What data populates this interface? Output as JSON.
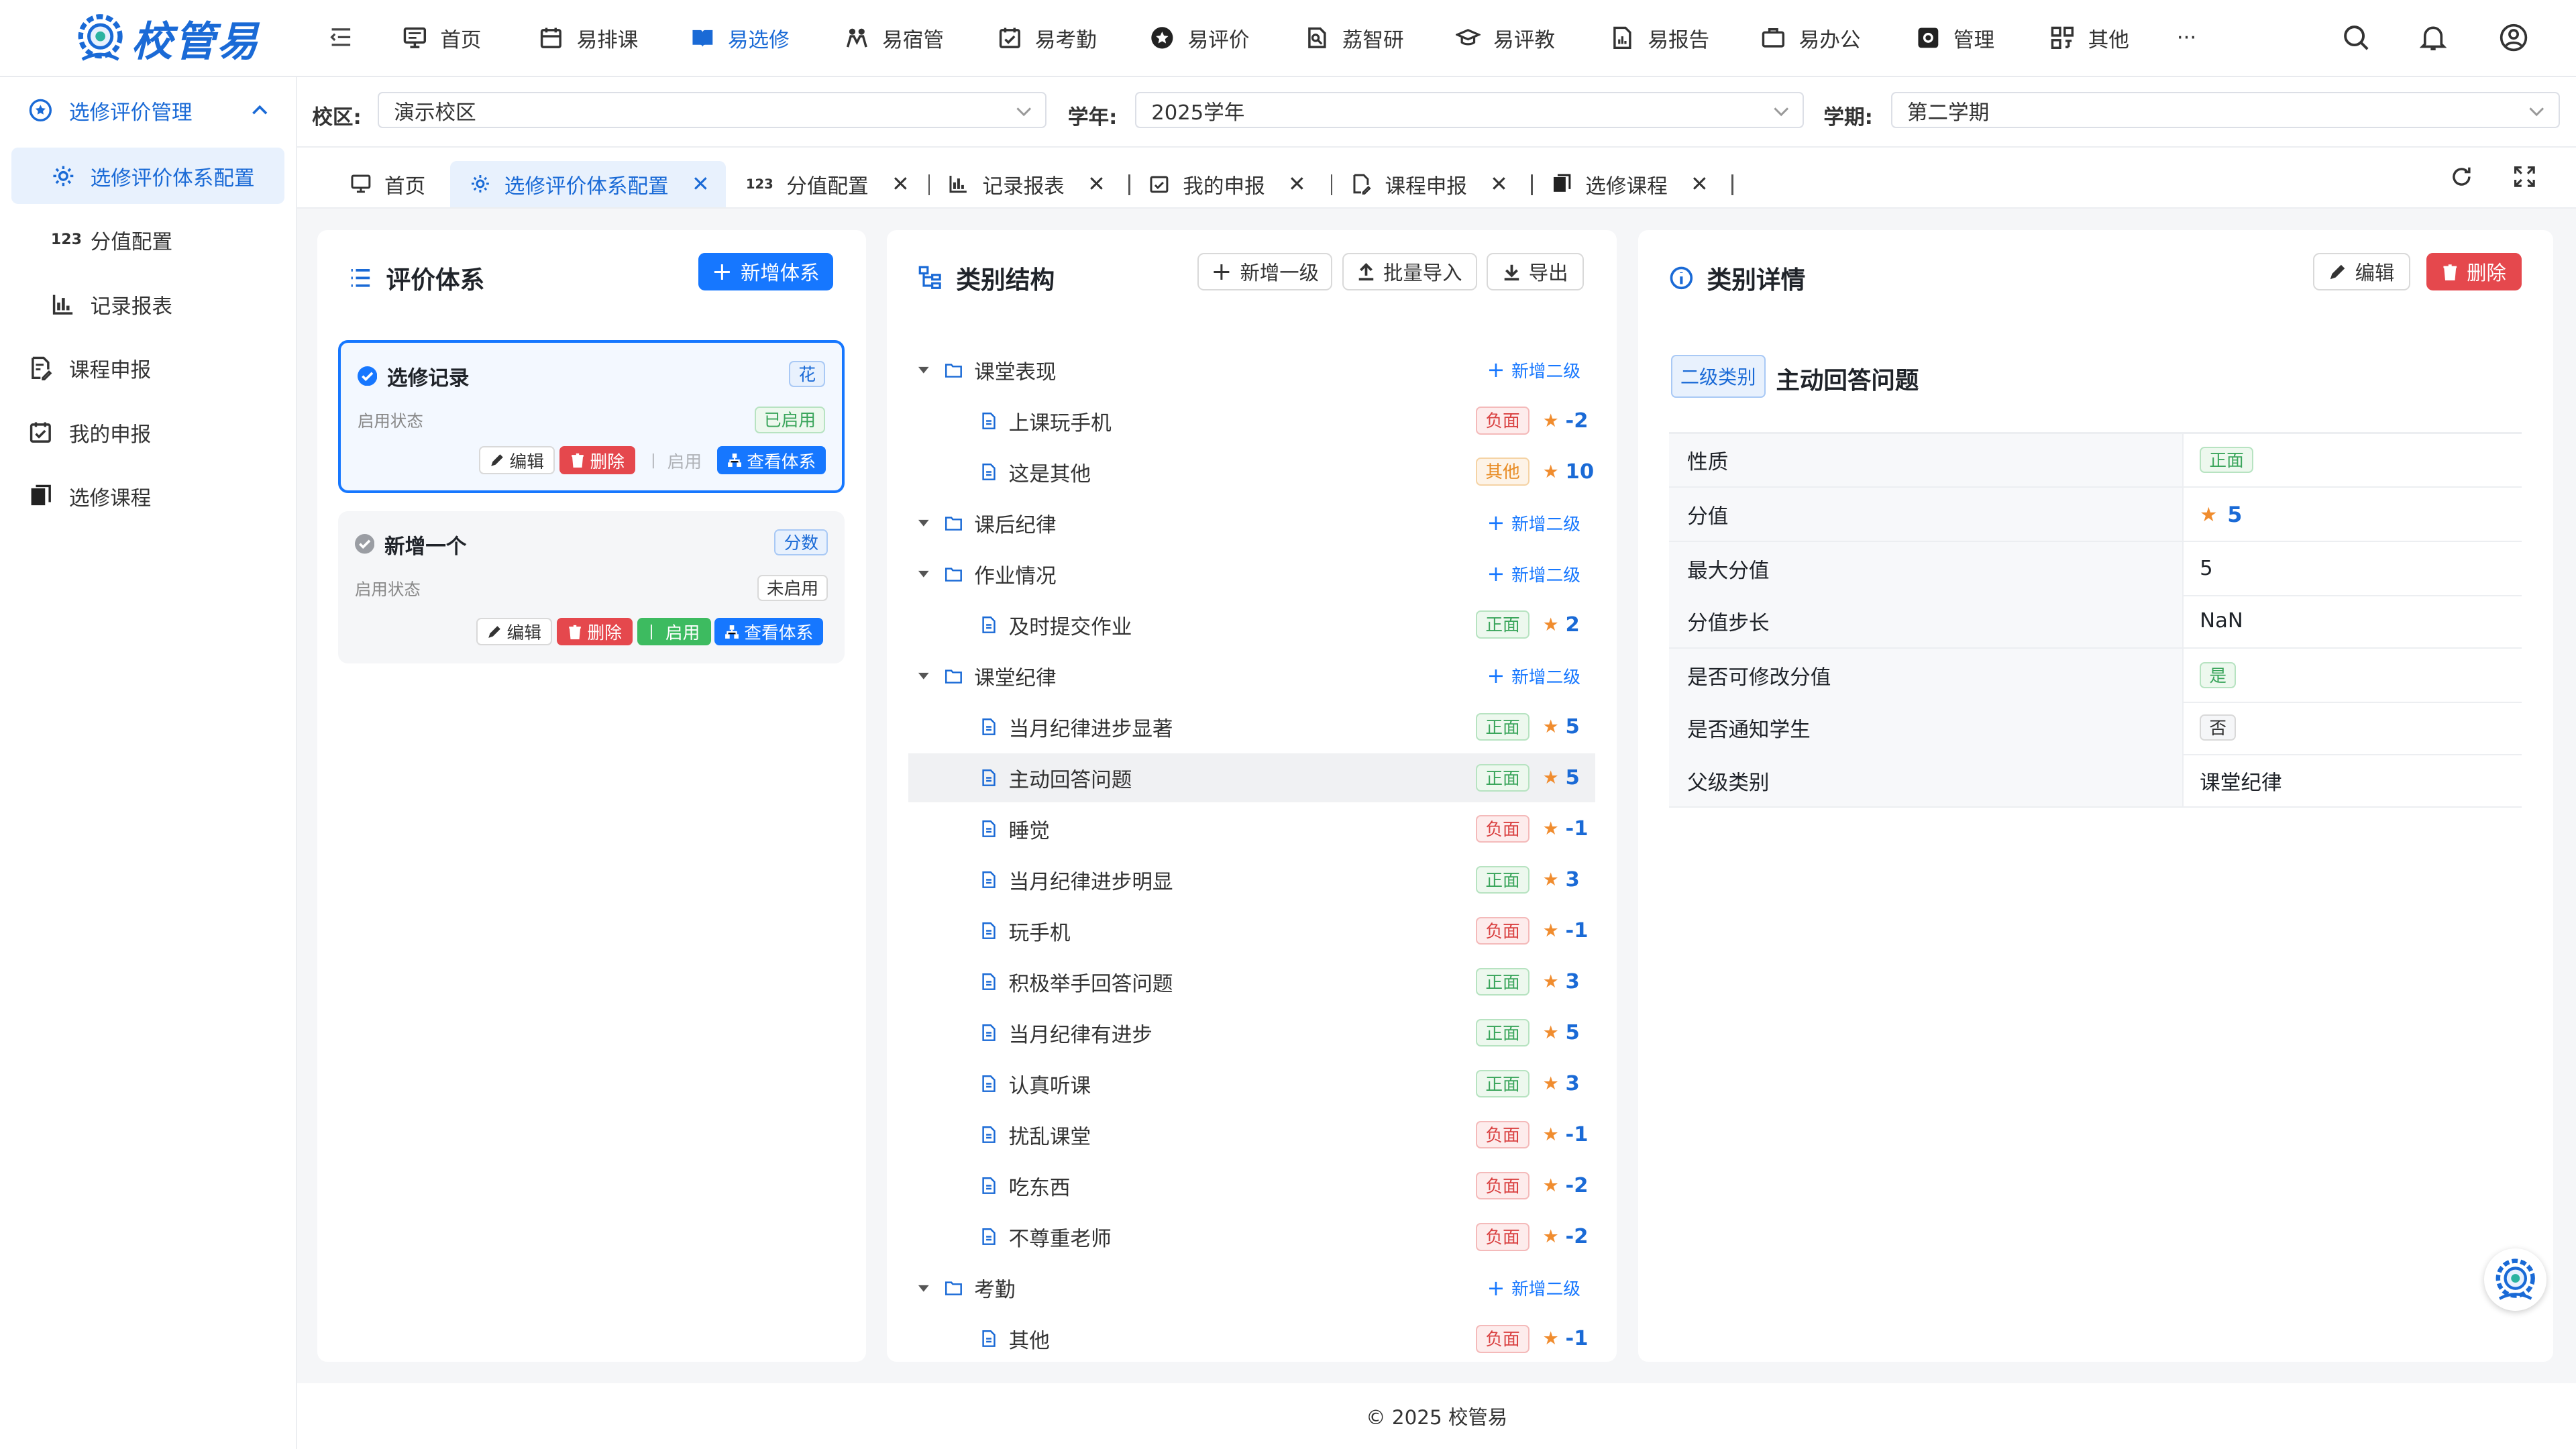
{
  "app": {
    "logo_text": "校管易"
  },
  "nav": {
    "items": [
      {
        "label": "首页",
        "icon": "monitor-icon"
      },
      {
        "label": "易排课",
        "icon": "calendar-icon"
      },
      {
        "label": "易选修",
        "icon": "book-icon"
      },
      {
        "label": "易宿管",
        "icon": "users-icon"
      },
      {
        "label": "易考勤",
        "icon": "calendar-check-icon"
      },
      {
        "label": "易评价",
        "icon": "star-icon"
      },
      {
        "label": "荔智研",
        "icon": "research-icon"
      },
      {
        "label": "易评教",
        "icon": "graduation-icon"
      },
      {
        "label": "易报告",
        "icon": "report-icon"
      },
      {
        "label": "易办公",
        "icon": "briefcase-icon"
      },
      {
        "label": "管理",
        "icon": "settings-icon"
      },
      {
        "label": "其他",
        "icon": "grid-icon"
      }
    ],
    "more": "···"
  },
  "sidebar": {
    "group": "选修评价管理",
    "items": [
      {
        "label": "选修评价体系配置"
      },
      {
        "label": "分值配置"
      },
      {
        "label": "记录报表"
      },
      {
        "label": "课程申报"
      },
      {
        "label": "我的申报"
      },
      {
        "label": "选修课程"
      }
    ]
  },
  "filters": {
    "campus_label": "校区:",
    "campus_value": "演示校区",
    "year_label": "学年:",
    "year_value": "2025学年",
    "term_label": "学期:",
    "term_value": "第二学期"
  },
  "tabs": [
    {
      "label": "首页"
    },
    {
      "label": "选修评价体系配置"
    },
    {
      "label": "分值配置"
    },
    {
      "label": "记录报表"
    },
    {
      "label": "我的申报"
    },
    {
      "label": "课程申报"
    },
    {
      "label": "选修课程"
    }
  ],
  "systems_panel": {
    "title": "评价体系",
    "add_button": "新增体系",
    "cards": [
      {
        "name": "选修记录",
        "type_tag": "花",
        "status_label": "启用状态",
        "status": "已启用",
        "edit": "编辑",
        "delete": "删除",
        "enable": "启用",
        "view": "查看体系"
      },
      {
        "name": "新增一个",
        "type_tag": "分数",
        "status_label": "启用状态",
        "status": "未启用",
        "edit": "编辑",
        "delete": "删除",
        "enable": "启用",
        "view": "查看体系"
      }
    ]
  },
  "tree_panel": {
    "title": "类别结构",
    "btn_add_level1": "新增一级",
    "btn_import": "批量导入",
    "btn_export": "导出",
    "add_sub_label": "新增二级",
    "groups": [
      {
        "name": "课堂表现",
        "children": [
          {
            "name": "上课玩手机",
            "nature": "负面",
            "score": "-2"
          },
          {
            "name": "这是其他",
            "nature": "其他",
            "score": "10"
          }
        ]
      },
      {
        "name": "课后纪律",
        "children": []
      },
      {
        "name": "作业情况",
        "children": [
          {
            "name": "及时提交作业",
            "nature": "正面",
            "score": "2"
          }
        ]
      },
      {
        "name": "课堂纪律",
        "children": [
          {
            "name": "当月纪律进步显著",
            "nature": "正面",
            "score": "5"
          },
          {
            "name": "主动回答问题",
            "nature": "正面",
            "score": "5"
          },
          {
            "name": "睡觉",
            "nature": "负面",
            "score": "-1"
          },
          {
            "name": "当月纪律进步明显",
            "nature": "正面",
            "score": "3"
          },
          {
            "name": "玩手机",
            "nature": "负面",
            "score": "-1"
          },
          {
            "name": "积极举手回答问题",
            "nature": "正面",
            "score": "3"
          },
          {
            "name": "当月纪律有进步",
            "nature": "正面",
            "score": "5"
          },
          {
            "name": "认真听课",
            "nature": "正面",
            "score": "3"
          },
          {
            "name": "扰乱课堂",
            "nature": "负面",
            "score": "-1"
          },
          {
            "name": "吃东西",
            "nature": "负面",
            "score": "-2"
          },
          {
            "name": "不尊重老师",
            "nature": "负面",
            "score": "-2"
          }
        ]
      },
      {
        "name": "考勤",
        "children": [
          {
            "name": "其他",
            "nature": "负面",
            "score": "-1"
          }
        ]
      }
    ]
  },
  "detail_panel": {
    "title": "类别详情",
    "edit": "编辑",
    "delete": "删除",
    "level_badge": "二级类别",
    "name": "主动回答问题",
    "rows": [
      {
        "key": "性质",
        "value": "正面"
      },
      {
        "key": "分值",
        "value": "5"
      },
      {
        "key": "最大分值",
        "value": "5"
      },
      {
        "key": "分值步长",
        "value": "NaN"
      },
      {
        "key": "是否可修改分值",
        "value": "是"
      },
      {
        "key": "是否通知学生",
        "value": "否"
      },
      {
        "key": "父级类别",
        "value": "课堂纪律"
      }
    ]
  },
  "footer": "© 2025 校管易",
  "colors": {
    "primary": "#1677ff",
    "danger": "#e5484d",
    "success": "#3aa55b",
    "accent_text": "#1a6ad6"
  }
}
